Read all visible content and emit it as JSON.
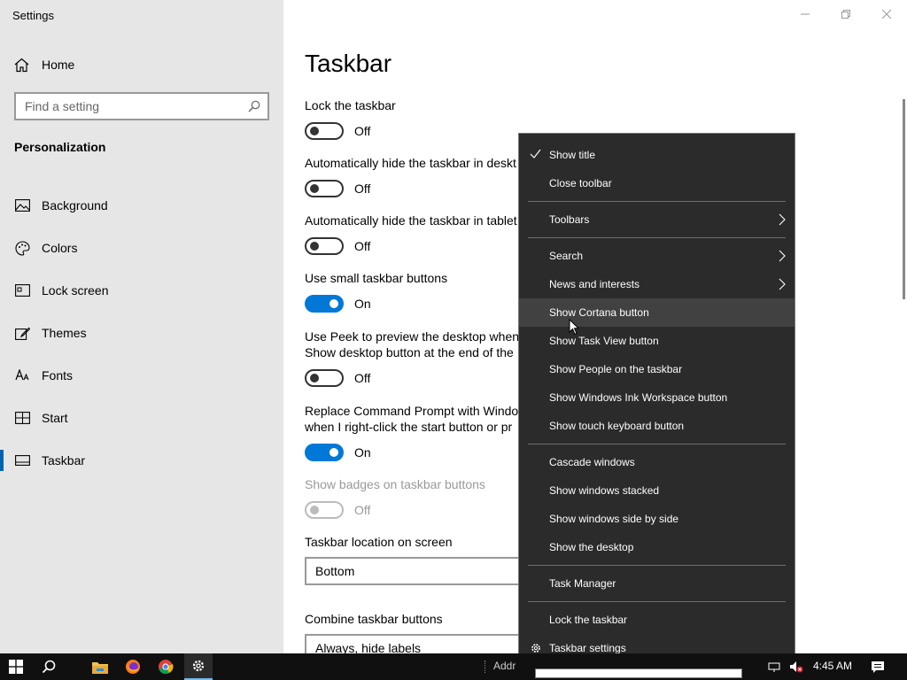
{
  "window": {
    "title": "Settings",
    "minimize_icon": "minimize-icon",
    "restore_icon": "restore-icon",
    "close_icon": "close-icon"
  },
  "sidebar": {
    "home_label": "Home",
    "search_placeholder": "Find a setting",
    "section_title": "Personalization",
    "items": [
      {
        "label": "Background",
        "icon": "picture-icon"
      },
      {
        "label": "Colors",
        "icon": "palette-icon"
      },
      {
        "label": "Lock screen",
        "icon": "lock-screen-icon"
      },
      {
        "label": "Themes",
        "icon": "brush-icon"
      },
      {
        "label": "Fonts",
        "icon": "font-icon"
      },
      {
        "label": "Start",
        "icon": "start-icon"
      },
      {
        "label": "Taskbar",
        "icon": "taskbar-icon",
        "active": true
      }
    ]
  },
  "main": {
    "title": "Taskbar",
    "settings": [
      {
        "label": "Lock the taskbar",
        "state": "Off"
      },
      {
        "label": "Automatically hide the taskbar in deskt",
        "state": "Off"
      },
      {
        "label": "Automatically hide the taskbar in tablet",
        "state": "Off"
      },
      {
        "label": "Use small taskbar buttons",
        "state": "On"
      },
      {
        "label_line1": "Use Peek to preview the desktop when",
        "label_line2": "Show desktop button at the end of the",
        "state": "Off"
      },
      {
        "label_line1": "Replace Command Prompt with Windo",
        "label_line2": "when I right-click the start button or pr",
        "state": "On"
      },
      {
        "label": "Show badges on taskbar buttons",
        "state": "Off",
        "disabled": true
      }
    ],
    "location_label": "Taskbar location on screen",
    "location_value": "Bottom",
    "combine_label": "Combine taskbar buttons",
    "combine_value": "Always, hide labels"
  },
  "context_menu": {
    "items": [
      {
        "label": "Show title",
        "checked": true
      },
      {
        "label": "Close toolbar"
      },
      {
        "label": "Toolbars",
        "submenu": true
      },
      {
        "label": "Search",
        "submenu": true
      },
      {
        "label": "News and interests",
        "submenu": true
      },
      {
        "label": "Show Cortana button",
        "hovered": true
      },
      {
        "label": "Show Task View button"
      },
      {
        "label": "Show People on the taskbar"
      },
      {
        "label": "Show Windows Ink Workspace button"
      },
      {
        "label": "Show touch keyboard button"
      },
      {
        "label": "Cascade windows"
      },
      {
        "label": "Show windows stacked"
      },
      {
        "label": "Show windows side by side"
      },
      {
        "label": "Show the desktop"
      },
      {
        "label": "Task Manager"
      },
      {
        "label": "Lock the taskbar"
      },
      {
        "label": "Taskbar settings",
        "icon": "gear-icon"
      }
    ]
  },
  "taskbar": {
    "address_label": "Addr",
    "time": "4:45 AM",
    "accent_color": "#0078d7"
  }
}
